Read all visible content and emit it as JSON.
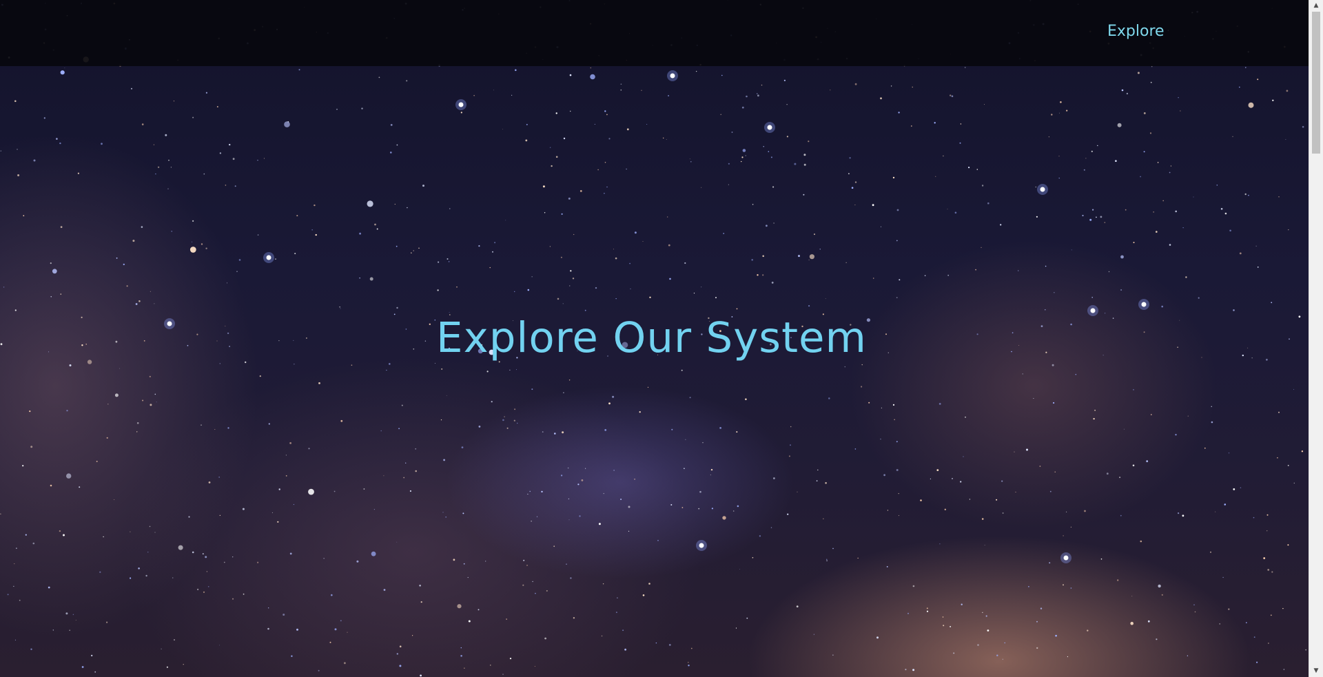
{
  "navbar": {
    "links": [
      {
        "label": "Explore"
      }
    ]
  },
  "hero": {
    "title": "Explore Our System"
  },
  "scrollbar": {
    "up_icon": "triangle-up-icon",
    "down_icon": "triangle-down-icon",
    "position": 0
  },
  "colors": {
    "accent": "#72d2f0",
    "nav_link": "#7fd8ec",
    "navbar_bg": "#08080e"
  }
}
